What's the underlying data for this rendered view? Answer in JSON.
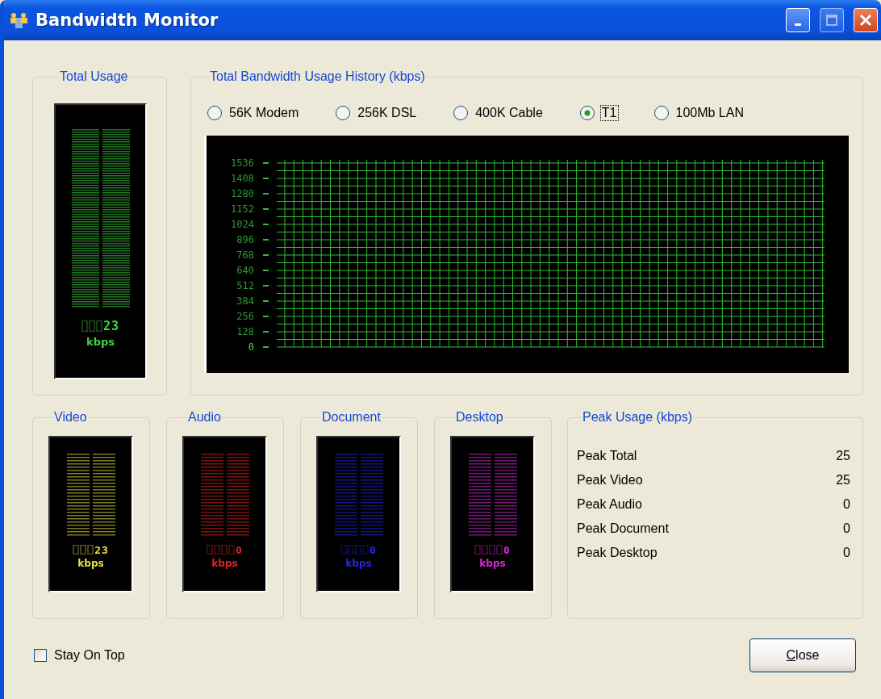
{
  "window": {
    "title": "Bandwidth Monitor"
  },
  "total_usage": {
    "title": "Total Usage",
    "meter": {
      "reading": "23",
      "unit": "kbps",
      "color": "#3fd43f"
    }
  },
  "history": {
    "title": "Total Bandwidth Usage History (kbps)",
    "scales": [
      {
        "label": "56K Modem",
        "selected": false,
        "focused": false
      },
      {
        "label": "256K DSL",
        "selected": false,
        "focused": false
      },
      {
        "label": "400K Cable",
        "selected": false,
        "focused": false
      },
      {
        "label": "T1",
        "selected": true,
        "focused": true
      },
      {
        "label": "100Mb LAN",
        "selected": false,
        "focused": false
      }
    ],
    "y_axis_labels": [
      "1536",
      "1408",
      "1280",
      "1152",
      "1024",
      "896",
      "768",
      "640",
      "512",
      "384",
      "256",
      "128",
      "0"
    ]
  },
  "channels": [
    {
      "title": "Video",
      "reading": "23",
      "unit": "kbps",
      "color": "#e8e23c"
    },
    {
      "title": "Audio",
      "reading": "0",
      "unit": "kbps",
      "color": "#e22222"
    },
    {
      "title": "Document",
      "reading": "0",
      "unit": "kbps",
      "color": "#2424e6"
    },
    {
      "title": "Desktop",
      "reading": "0",
      "unit": "kbps",
      "color": "#d42ad4"
    }
  ],
  "peak_usage": {
    "title": "Peak Usage (kbps)",
    "rows": [
      {
        "label": "Peak Total",
        "value": "25"
      },
      {
        "label": "Peak Video",
        "value": "25"
      },
      {
        "label": "Peak Audio",
        "value": "0"
      },
      {
        "label": "Peak Document",
        "value": "0"
      },
      {
        "label": "Peak Desktop",
        "value": "0"
      }
    ]
  },
  "stay_on_top": {
    "label": "Stay On Top",
    "checked": false
  },
  "buttons": [
    "Close"
  ]
}
